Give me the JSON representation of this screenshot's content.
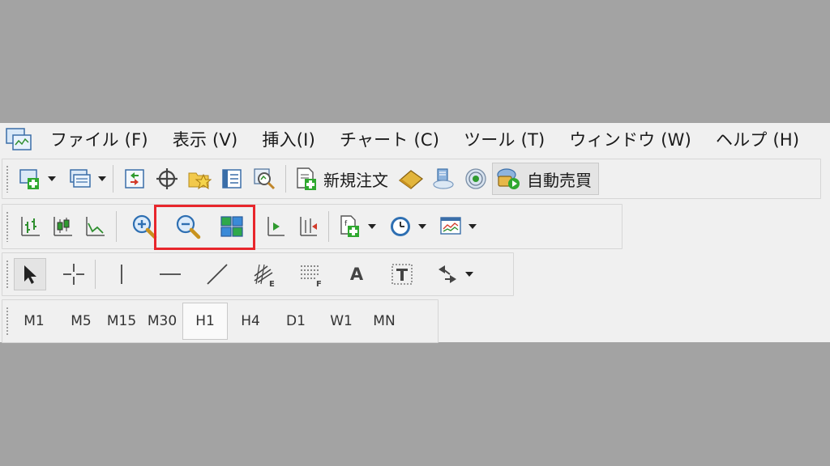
{
  "menu": {
    "items": [
      {
        "label": "ファイル (F)"
      },
      {
        "label": "表示 (V)"
      },
      {
        "label": "挿入(I)"
      },
      {
        "label": "チャート (C)"
      },
      {
        "label": "ツール (T)"
      },
      {
        "label": "ウィンドウ (W)"
      },
      {
        "label": "ヘルプ (H)"
      }
    ]
  },
  "toolbar_standard": {
    "new_order_label": "新規注文",
    "auto_trading_label": "自動売買"
  },
  "toolbar_drawing": {
    "text_tool_label": "A"
  },
  "timeframes": {
    "items": [
      "M1",
      "M5",
      "M15",
      "M30",
      "H1",
      "H4",
      "D1",
      "W1",
      "MN"
    ],
    "active": "H1"
  },
  "colors": {
    "highlight": "#e8262c",
    "background": "#a3a3a3",
    "toolbar": "#f0f0f0"
  }
}
